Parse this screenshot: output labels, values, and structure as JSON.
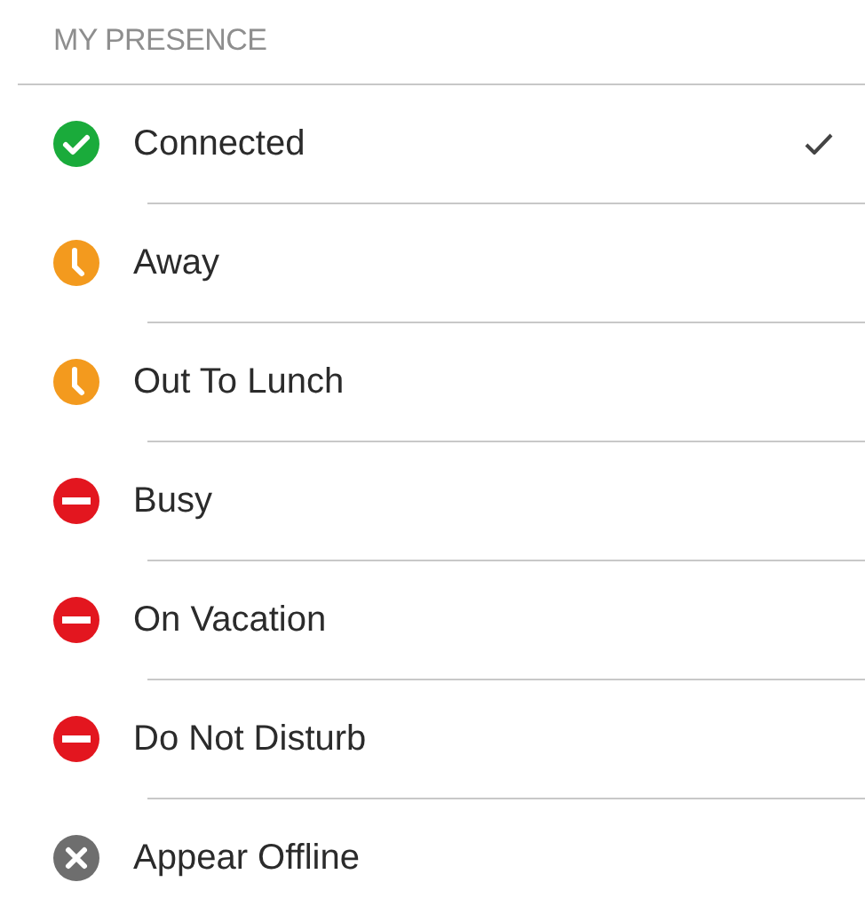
{
  "section": {
    "title": "MY PRESENCE"
  },
  "items": [
    {
      "label": "Connected",
      "kind": "available",
      "selected": true
    },
    {
      "label": "Away",
      "kind": "away",
      "selected": false
    },
    {
      "label": "Out To Lunch",
      "kind": "away",
      "selected": false
    },
    {
      "label": "Busy",
      "kind": "busy",
      "selected": false
    },
    {
      "label": "On Vacation",
      "kind": "busy",
      "selected": false
    },
    {
      "label": "Do Not Disturb",
      "kind": "busy",
      "selected": false
    },
    {
      "label": "Appear Offline",
      "kind": "offline",
      "selected": false
    }
  ]
}
